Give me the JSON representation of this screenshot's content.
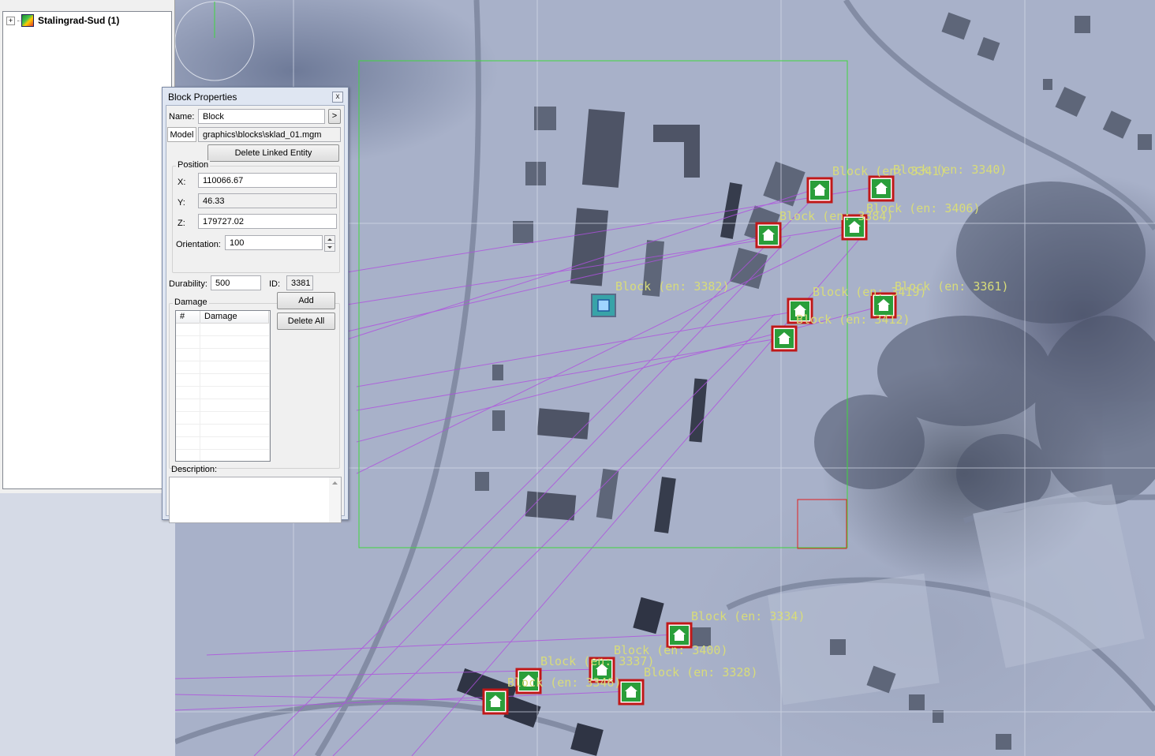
{
  "tree": {
    "expander": "+",
    "root_label": "Stalingrad-Sud (1)"
  },
  "dialog": {
    "title": "Block Properties",
    "close_glyph": "x",
    "name_label": "Name:",
    "name_value": "Block",
    "name_button": ">",
    "model_label": "Model",
    "model_value": "graphics\\blocks\\sklad_01.mgm",
    "delete_linked_label": "Delete Linked Entity",
    "position_group": "Position",
    "x_label": "X:",
    "x_value": "110066.67",
    "y_label": "Y:",
    "y_value": "46.33",
    "z_label": "Z:",
    "z_value": "179727.02",
    "orientation_label": "Orientation:",
    "orientation_value": "100",
    "durability_label": "Durability:",
    "durability_value": "500",
    "id_label": "ID:",
    "id_value": "3381",
    "damage_group": "Damage",
    "damage_columns": [
      "#",
      "Damage"
    ],
    "add_label": "Add",
    "delete_all_label": "Delete All",
    "description_label": "Description:",
    "description_value": ""
  },
  "map": {
    "selected_label": "Block (en: 3382)",
    "block_labels": [
      "Block (en: 3341)",
      "Block (en: 3340)",
      "Block (en: 3384)",
      "Block (en: 3406)",
      "Block (en: 3419)",
      "Block (en: 3361)",
      "Block (en: 3412)",
      "Block (en: 3334)",
      "Block (en: 3400)",
      "Block (en: 3337)",
      "Block (en: 3328)",
      "Block (en: 3346)"
    ],
    "colors": {
      "selection_box": "#3fd63f",
      "red_box": "#e02020",
      "links": "#b050e0",
      "labels": "#d8dc7a",
      "marker_fill": "#2a9e3a",
      "marker_border": "#c01818"
    }
  }
}
